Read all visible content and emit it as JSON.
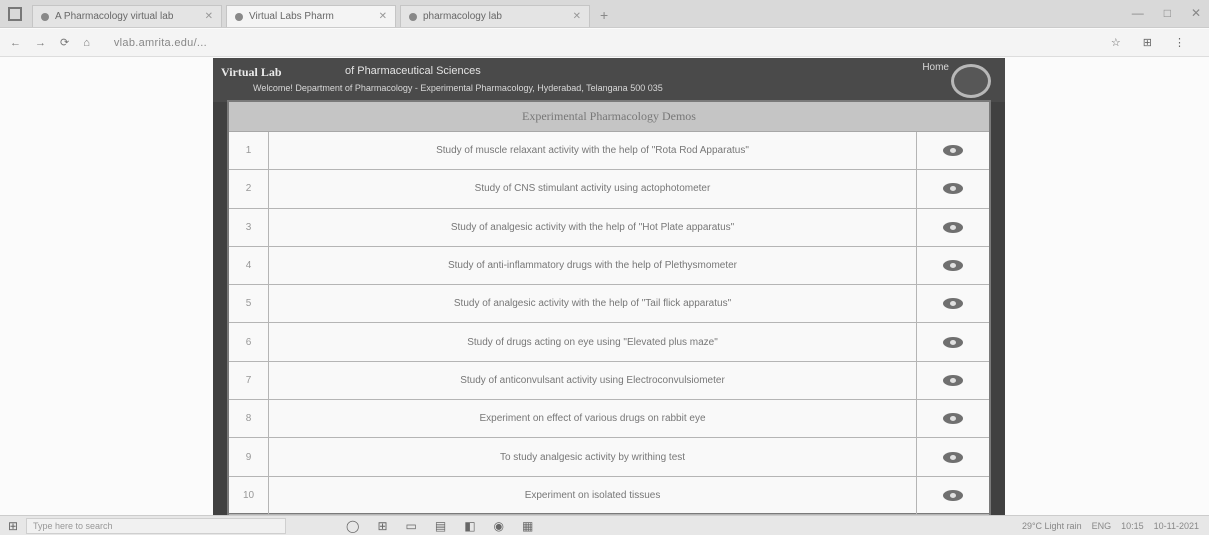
{
  "browser": {
    "tabs": [
      {
        "label": "A Pharmacology virtual lab"
      },
      {
        "label": "Virtual Labs Pharm"
      },
      {
        "label": "pharmacology lab"
      }
    ],
    "new_tab": "+",
    "url": "vlab.amrita.edu/...",
    "window_controls": [
      "—",
      "□",
      "✕"
    ],
    "nav": [
      "←",
      "→",
      "⟳",
      "⌂"
    ],
    "toolbar_icons": [
      "☆",
      "⊞",
      "⋮"
    ]
  },
  "site": {
    "brand": "Virtual Lab",
    "institute": "of Pharmaceutical Sciences",
    "welcome": "Welcome! Department of Pharmacology - Experimental Pharmacology, Hyderabad, Telangana 500 035",
    "home_label": "Home"
  },
  "panel": {
    "title": "Experimental Pharmacology Demos",
    "rows": [
      {
        "num": "1",
        "text": "Study of muscle relaxant activity with the help of \"Rota Rod Apparatus\""
      },
      {
        "num": "2",
        "text": "Study of CNS stimulant activity using actophotometer"
      },
      {
        "num": "3",
        "text": "Study of analgesic activity with the help of \"Hot Plate apparatus\""
      },
      {
        "num": "4",
        "text": "Study of anti-inflammatory drugs with the help of Plethysmometer"
      },
      {
        "num": "5",
        "text": "Study of analgesic activity with the help of \"Tail flick apparatus\""
      },
      {
        "num": "6",
        "text": "Study of drugs acting on eye using \"Elevated plus maze\""
      },
      {
        "num": "7",
        "text": "Study of anticonvulsant activity using Electroconvulsiometer"
      },
      {
        "num": "8",
        "text": "Experiment on effect of various drugs on rabbit eye"
      },
      {
        "num": "9",
        "text": "To study analgesic activity by writhing test"
      },
      {
        "num": "10",
        "text": "Experiment on isolated tissues"
      }
    ]
  },
  "taskbar": {
    "start_icon": "windows-icon",
    "search_placeholder": "Type here to search",
    "apps": [
      "◯",
      "⊞",
      "▭",
      "▤",
      "◧",
      "◉",
      "▦"
    ],
    "tray": [
      "29°C Light rain",
      "ENG",
      "10:15",
      "10-11-2021"
    ]
  }
}
